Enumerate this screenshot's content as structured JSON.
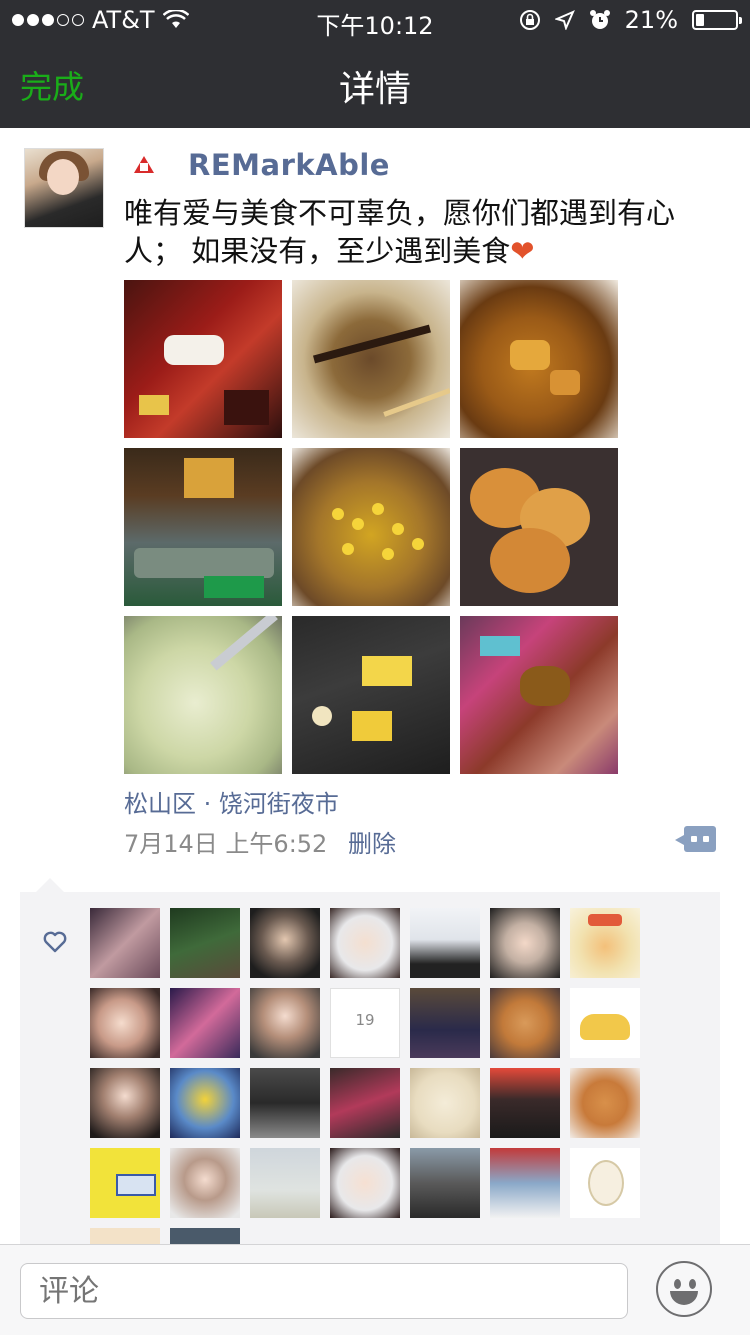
{
  "status_bar": {
    "carrier": "AT&T",
    "time": "下午10:12",
    "battery": "21%",
    "battery_level": 0.21
  },
  "nav": {
    "done": "完成",
    "title": "详情"
  },
  "post": {
    "username": "REMarkAble",
    "text": "唯有爱与美食不可辜负，愿你们都遇到有心人；  如果没有，至少遇到美食",
    "emoji": "❤",
    "location": "松山区 · 饶河街夜市",
    "time": "7月14日 上午6:52",
    "delete_label": "删除"
  },
  "photos": [
    "bento-box-photo",
    "okonomiyaki-photo",
    "braised-food-photo",
    "night-market-stall-photo",
    "corn-dish-photo",
    "pancakes-photo",
    "soup-photo",
    "egg-skillets-photo",
    "dessert-box-photo"
  ],
  "likes": {
    "badge_number": "19",
    "avatars": [
      "avatar-1",
      "avatar-2",
      "avatar-3",
      "avatar-4",
      "avatar-5",
      "avatar-6",
      "avatar-7",
      "avatar-8",
      "avatar-9",
      "avatar-10",
      "avatar-11",
      "avatar-12",
      "avatar-13",
      "avatar-14",
      "avatar-15",
      "avatar-16",
      "avatar-17",
      "avatar-18",
      "avatar-19",
      "avatar-20",
      "avatar-21",
      "avatar-22",
      "avatar-23",
      "avatar-24",
      "avatar-25",
      "avatar-26",
      "avatar-27",
      "avatar-28",
      "avatar-29",
      "avatar-30"
    ]
  },
  "comment": {
    "placeholder": "评论"
  },
  "icons": {
    "wifi": "wifi-icon",
    "lock": "rotation-lock-icon",
    "location": "location-arrow-icon",
    "alarm": "alarm-icon",
    "like": "heart-icon",
    "more": "comment-more-icon",
    "emoji": "emoji-icon"
  }
}
